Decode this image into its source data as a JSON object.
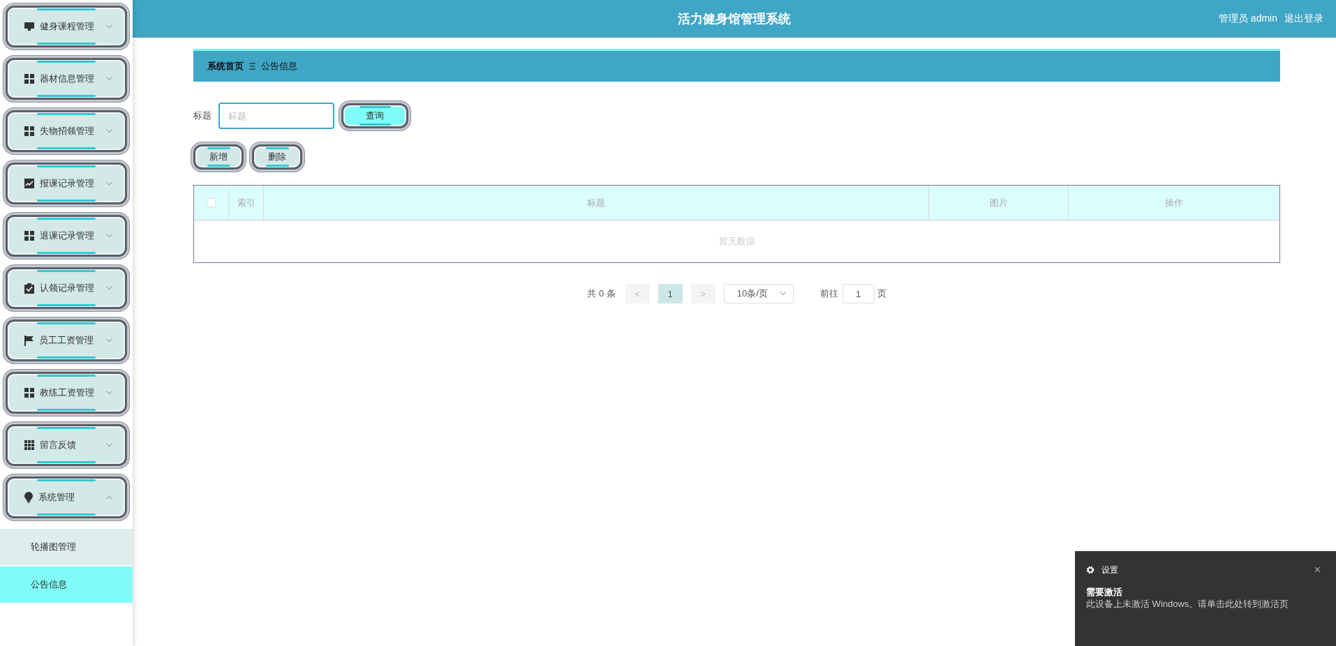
{
  "header": {
    "title": "活力健身馆管理系统",
    "user": "管理员 admin",
    "logout": "退出登录"
  },
  "sidebar": {
    "items": [
      {
        "label": "健身课程管理",
        "expanded": false
      },
      {
        "label": "器材信息管理",
        "expanded": false
      },
      {
        "label": "失物招领管理",
        "expanded": false
      },
      {
        "label": "报课记录管理",
        "expanded": false
      },
      {
        "label": "退课记录管理",
        "expanded": false
      },
      {
        "label": "认领记录管理",
        "expanded": false
      },
      {
        "label": "员工工资管理",
        "expanded": false
      },
      {
        "label": "教练工资管理",
        "expanded": false
      },
      {
        "label": "留言反馈",
        "expanded": false
      },
      {
        "label": "系统管理",
        "expanded": true,
        "children": [
          {
            "label": "轮播图管理",
            "selected": false
          },
          {
            "label": "公告信息",
            "selected": true
          }
        ]
      }
    ]
  },
  "breadcrumb": {
    "home": "系统首页",
    "current": "公告信息"
  },
  "search": {
    "label": "标题",
    "placeholder": "标题",
    "button": "查询"
  },
  "actions": [
    "新增",
    "删除"
  ],
  "table": {
    "select_all_checked": false,
    "columns": [
      "索引",
      "标题",
      "图片",
      "操作"
    ],
    "empty_text": "暂无数据"
  },
  "pagination": {
    "total": "共 0 条",
    "prev": "<",
    "pages": [
      {
        "label": "1",
        "selected": true
      }
    ],
    "next": ">",
    "page_size": "10条/页",
    "goto": "前往",
    "page_input": "1",
    "page_unit": "页"
  },
  "toast": {
    "app": "设置",
    "close": "×",
    "title": "需要激活",
    "message": "此设备上未激活 Windows。请单击此处转到激活页"
  }
}
